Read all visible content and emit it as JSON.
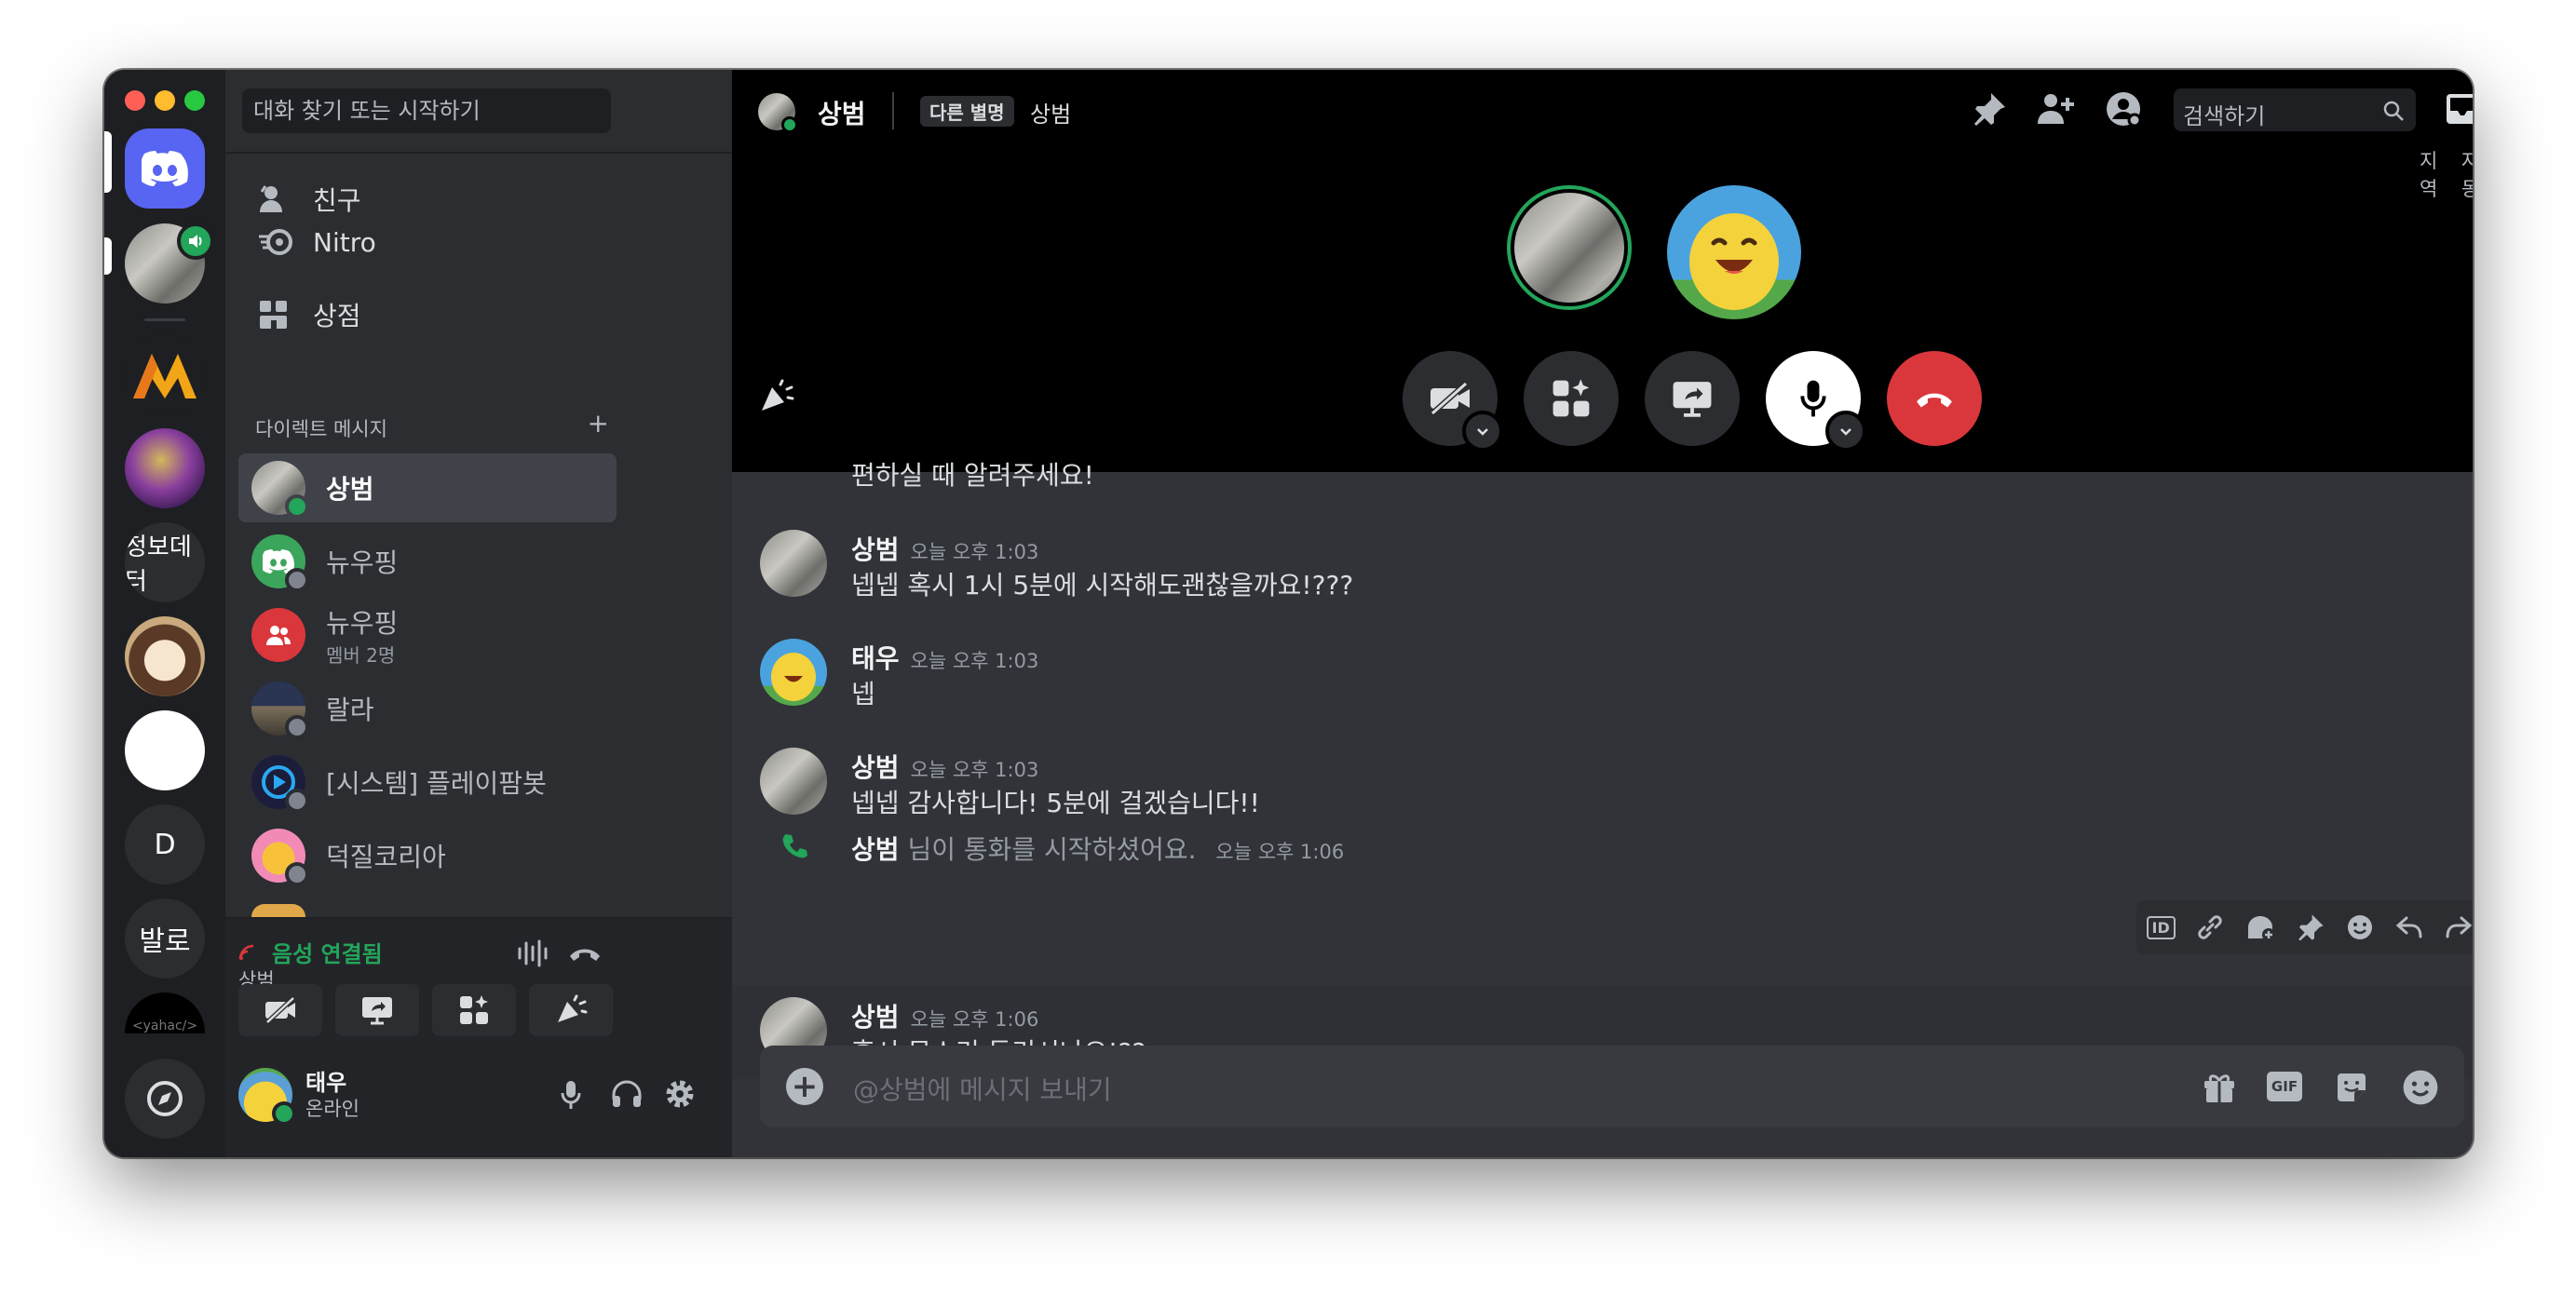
{
  "sidebar": {
    "search_placeholder": "대화 찾기 또는 시작하기",
    "nav": [
      {
        "label": "친구"
      },
      {
        "label": "Nitro"
      },
      {
        "label": "상점"
      }
    ],
    "dm_header": "다이렉트 메시지",
    "dms": [
      {
        "name": "상범",
        "sub": ""
      },
      {
        "name": "뉴우핑",
        "sub": ""
      },
      {
        "name": "뉴우핑",
        "sub": "멤버 2명"
      },
      {
        "name": "랄라",
        "sub": ""
      },
      {
        "name": "[시스템] 플레이팜봇",
        "sub": ""
      },
      {
        "name": "덕질코리아",
        "sub": ""
      }
    ]
  },
  "servers": {
    "labels": [
      "정보데터",
      "D",
      "발로",
      "<yahac/>"
    ]
  },
  "voice_panel": {
    "status": "음성 연결됨",
    "channel": "상범"
  },
  "user_panel": {
    "name": "태우",
    "status": "온라인"
  },
  "header": {
    "name": "상범",
    "nickname_badge": "다른 별명",
    "nickname": "상범",
    "search_placeholder": "검색하기",
    "region_label": "지역",
    "region_value": "자동"
  },
  "messages": [
    {
      "author": "",
      "time": "",
      "text": "편하실 때 알려주세요!"
    },
    {
      "author": "상범",
      "time": "오늘 오후 1:03",
      "text": "넵넵 혹시 1시 5분에 시작해도괜찮을까요!???"
    },
    {
      "author": "태우",
      "time": "오늘 오후 1:03",
      "text": "넵"
    },
    {
      "author": "상범",
      "time": "오늘 오후 1:03",
      "text": "넵넵 감사합니다! 5분에 걸겠습니다!!"
    },
    {
      "author": "상범",
      "time": "오늘 오후 1:06",
      "text": "님이 통화를 시작하셨어요."
    },
    {
      "author": "상범",
      "time": "오늘 오후 1:06",
      "text": "혹시 목소리 들리시나요!??"
    }
  ],
  "composer": {
    "placeholder": "@상범에 메시지 보내기",
    "gif_label": "GIF"
  },
  "toolbar": {
    "id_label": "ID"
  },
  "colors": {
    "blurple": "#5865f2",
    "green": "#23a55a",
    "red": "#da373c",
    "bg_main": "#313338",
    "bg_sidebar": "#2b2d31",
    "bg_rail": "#1e1f22"
  }
}
